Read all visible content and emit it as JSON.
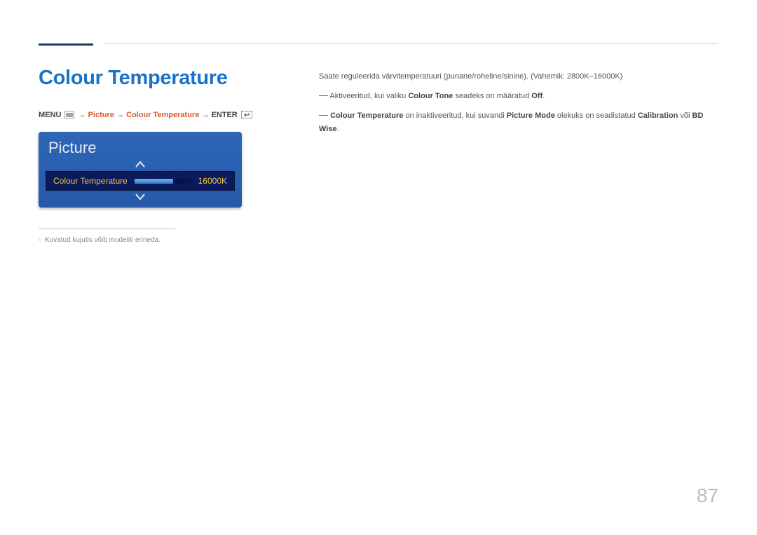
{
  "heading": "Colour Temperature",
  "breadcrumb": {
    "menu_label": "MENU",
    "arrow": "→",
    "seg1": "Picture",
    "seg2": "Colour Temperature",
    "enter_label": "ENTER"
  },
  "menu": {
    "title": "Picture",
    "item_label": "Colour Temperature",
    "item_value": "16000K"
  },
  "caption": "Kuvatud kujutis võib mudeliti erineda.",
  "right": {
    "main": "Saate reguleerida värvitemperatuuri (punane/roheline/sinine). (Vahemik: 2800K–16000K)",
    "note1_a": "Aktiveeritud, kui valiku ",
    "note1_b": "Colour Tone",
    "note1_c": " seadeks on määratud ",
    "note1_d": "Off",
    "note1_e": ".",
    "note2_a": "Colour Temperature",
    "note2_b": " on inaktiveeritud, kui suvandi ",
    "note2_c": "Picture Mode",
    "note2_d": " olekuks on seadistatud ",
    "note2_e": "Calibration",
    "note2_f": " või ",
    "note2_g": "BD Wise",
    "note2_h": "."
  },
  "page_number": "87"
}
